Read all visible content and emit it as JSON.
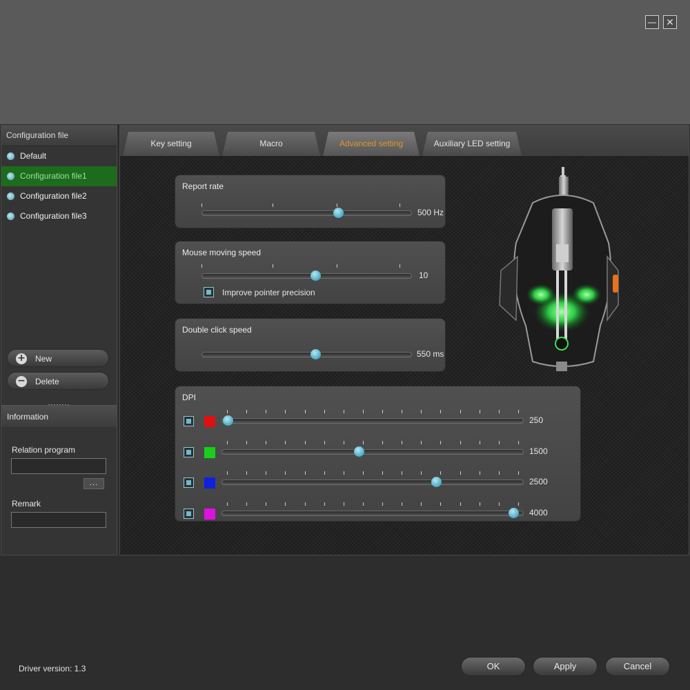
{
  "window": {
    "minimize_icon": "minimize-icon",
    "close_icon": "close-icon",
    "minimize_glyph": "—",
    "close_glyph": "✕"
  },
  "sidebar": {
    "header": "Configuration file",
    "items": [
      {
        "label": "Default",
        "active": false
      },
      {
        "label": "Configuration file1",
        "active": true
      },
      {
        "label": "Configuration file2",
        "active": false
      },
      {
        "label": "Configuration file3",
        "active": false
      }
    ],
    "new_label": "New",
    "delete_label": "Delete",
    "new_glyph": "+",
    "delete_glyph": "−"
  },
  "information": {
    "header": "Information",
    "relation_label": "Relation program",
    "relation_value": "",
    "browse_label": "...",
    "remark_label": "Remark",
    "remark_value": ""
  },
  "tabs": [
    {
      "label": "Key setting",
      "active": false
    },
    {
      "label": "Macro",
      "active": false
    },
    {
      "label": "Advanced setting",
      "active": true
    },
    {
      "label": "Auxiliary LED setting",
      "active": false
    }
  ],
  "report_rate": {
    "title": "Report rate",
    "value_text": "500 Hz",
    "position": 0.65,
    "ticks": 4
  },
  "mouse_speed": {
    "title": "Mouse moving speed",
    "value_text": "10",
    "position": 0.54,
    "ticks": 4,
    "precision_label": "Improve pointer precision",
    "precision_checked": true
  },
  "double_click": {
    "title": "Double click speed",
    "value_text": "550 ms",
    "position": 0.54,
    "ticks": 4
  },
  "dpi": {
    "title": "DPI",
    "levels": [
      {
        "value_text": "250",
        "color": "#e01010",
        "position": 0.02,
        "checked": true
      },
      {
        "value_text": "1500",
        "color": "#18d018",
        "position": 0.455,
        "checked": true
      },
      {
        "value_text": "2500",
        "color": "#1020e0",
        "position": 0.71,
        "checked": true
      },
      {
        "value_text": "4000",
        "color": "#e010e0",
        "position": 0.965,
        "checked": true
      }
    ]
  },
  "footer": {
    "driver_version": "Driver version:  1.3",
    "ok_label": "OK",
    "apply_label": "Apply",
    "cancel_label": "Cancel"
  },
  "colors": {
    "accent_tab": "#e0962a",
    "active_profile": "#1d6b1d",
    "slider_thumb": "#56b3cc"
  }
}
